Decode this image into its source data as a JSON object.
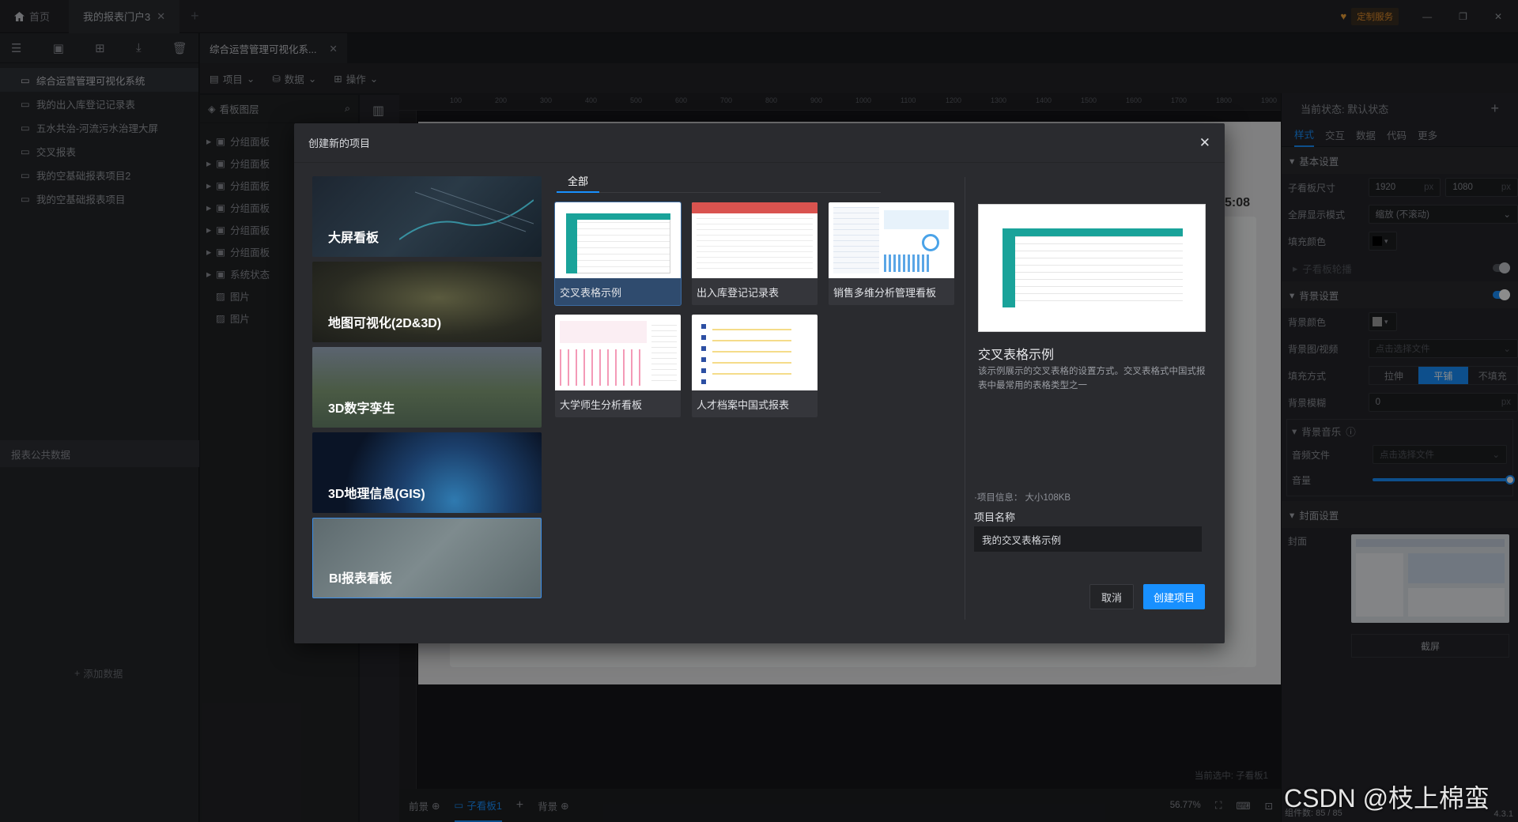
{
  "titlebar": {
    "tabs": [
      {
        "label": "首页"
      },
      {
        "label": "我的报表门户3"
      }
    ],
    "custom_service": "定制服务"
  },
  "left_panel": {
    "project_tab": "综合运营管理可视化系...",
    "projects": [
      "综合运营管理可视化系统",
      "我的出入库登记记录表",
      "五水共治-河流污水治理大屏",
      "交叉报表",
      "我的空基础报表项目2",
      "我的空基础报表项目"
    ],
    "public_data_title": "报表公共数据",
    "add_data": "添加数据"
  },
  "menu": {
    "project": "项目",
    "data": "数据",
    "operation": "操作"
  },
  "layers": {
    "title": "看板图层",
    "items": [
      "分组面板",
      "分组面板",
      "分组面板",
      "分组面板",
      "分组面板",
      "分组面板",
      "系统状态",
      "图片",
      "图片"
    ]
  },
  "canvas": {
    "time_fragment": "5:08",
    "current_selected": "当前选中: 子看板1",
    "bottom_tabs": [
      "前景",
      "子看板1",
      "背景"
    ],
    "zoom": "56.77%",
    "component_count": "组件数: 85 / 85",
    "version": "4.3.1",
    "ruler_ticks": [
      "100",
      "200",
      "300",
      "400",
      "500",
      "600",
      "700",
      "800",
      "900",
      "1000",
      "1100",
      "1200",
      "1300",
      "1400",
      "1500",
      "1600",
      "1700",
      "1800",
      "1900"
    ]
  },
  "right_panel": {
    "state": "当前状态: 默认状态",
    "tabs": [
      "样式",
      "交互",
      "数据",
      "代码",
      "更多"
    ],
    "basic_settings": "基本设置",
    "size_label": "子看板尺寸",
    "width": "1920",
    "height": "1080",
    "unit": "px",
    "fullscreen_label": "全屏显示模式",
    "fullscreen_value": "缩放 (不滚动)",
    "fill_color_label": "填充颜色",
    "carousel_label": "子看板轮播",
    "bg_settings": "背景设置",
    "bg_color_label": "背景颜色",
    "bg_image_label": "背景图/视频",
    "choose_file": "点击选择文件",
    "fill_mode_label": "填充方式",
    "fill_modes": [
      "拉伸",
      "平铺",
      "不填充"
    ],
    "bg_blur_label": "背景模糊",
    "bg_blur_value": "0",
    "bg_music_label": "背景音乐",
    "audio_file_label": "音频文件",
    "volume_label": "音量",
    "volume": 1.0,
    "cover_settings": "封面设置",
    "cover_label": "封面",
    "screenshot_btn": "截屏",
    "accent": "#1890ff"
  },
  "modal": {
    "title": "创建新的项目",
    "categories": [
      "大屏看板",
      "地图可视化(2D&3D)",
      "3D数字孪生",
      "3D地理信息(GIS)",
      "BI报表看板"
    ],
    "filter_tab": "全部",
    "templates": [
      "交叉表格示例",
      "出入库登记记录表",
      "销售多维分析管理看板",
      "大学师生分析看板",
      "人才档案中国式报表"
    ],
    "preview_title": "交叉表格示例",
    "preview_desc": "该示例展示的交叉表格的设置方式。交叉表格式中国式报表中最常用的表格类型之一",
    "project_info": "·项目信息：  大小108KB",
    "project_name_label": "项目名称",
    "project_name_value": "我的交叉表格示例",
    "cancel": "取消",
    "create": "创建项目"
  },
  "watermark": "CSDN @枝上棉蛮"
}
